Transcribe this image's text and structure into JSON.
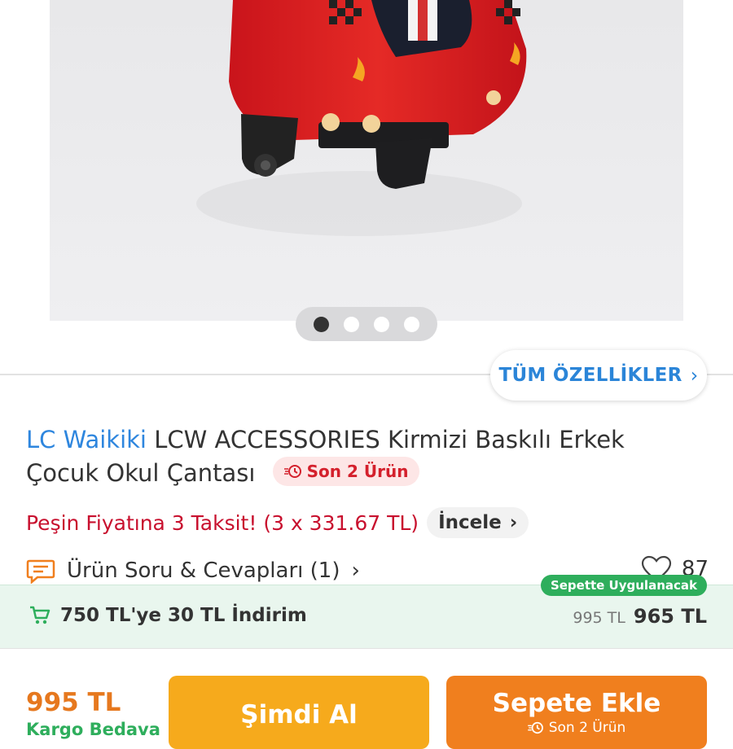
{
  "gallery": {
    "dot_count": 4,
    "active_index": 0
  },
  "specs_button": {
    "label": "TÜM ÖZELLİKLER"
  },
  "product": {
    "brand": "LC Waikiki",
    "name": "LCW ACCESSORIES Kirmizi Baskılı Erkek Çocuk Okul Çantası",
    "stock_badge": "Son 2 Ürün"
  },
  "installment": {
    "text": "Peşin Fiyatına 3 Taksit! (3 x 331.67 TL)",
    "review_label": "İncele"
  },
  "qa": {
    "label": "Ürün Soru & Cevapları (1)"
  },
  "favorites": {
    "count": "87"
  },
  "discount": {
    "tag": "Sepette Uygulanacak",
    "text": "750 TL'ye 30 TL İndirim",
    "old_price": "995 TL",
    "new_price": "965 TL"
  },
  "bottom_bar": {
    "price": "995 TL",
    "cargo": "Kargo Bedava",
    "buy_now_label": "Şimdi Al",
    "add_to_cart_label": "Sepete Ekle",
    "add_to_cart_sub": "Son 2 Ürün"
  },
  "colors": {
    "brand_blue": "#2e86de",
    "installment_red": "#c8102e",
    "discount_green": "#2eae5c",
    "buy_now": "#f6aa1c",
    "add_to_cart": "#f07f1e"
  }
}
